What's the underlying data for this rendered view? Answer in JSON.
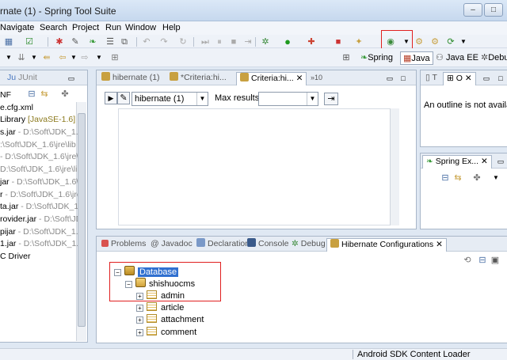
{
  "window": {
    "title": "rnate (1) - Spring Tool Suite",
    "min": "–",
    "max": "□",
    "close": "✕"
  },
  "menu": [
    "Navigate",
    "Search",
    "Project",
    "Run",
    "Window",
    "Help"
  ],
  "toolbar": {
    "perspectives": [
      "Spring",
      "Java",
      "Java EE",
      "Debu"
    ]
  },
  "left_panel": {
    "tab_label": "JUnit",
    "items": [
      {
        "text": "NF",
        "extra": ""
      },
      {
        "text": "e.cfg.xml",
        "extra": ""
      },
      {
        "text": "Library ",
        "extra": "[JavaSE-1.6]"
      },
      {
        "text": "s.jar",
        "extra": " - D:\\Soft\\JDK_1.6"
      },
      {
        "text": "",
        "extra": ":\\Soft\\JDK_1.6\\jre\\lib"
      },
      {
        "text": "",
        "extra": "- D:\\Soft\\JDK_1.6\\jre\\lil"
      },
      {
        "text": "",
        "extra": "D:\\Soft\\JDK_1.6\\jre\\lib"
      },
      {
        "text": "jar",
        "extra": " - D:\\Soft\\JDK_1.6\\jre"
      },
      {
        "text": "r",
        "extra": " - D:\\Soft\\JDK_1.6\\jre\\"
      },
      {
        "text": "ta.jar",
        "extra": " - D:\\Soft\\JDK_1.6"
      },
      {
        "text": "rovider.jar",
        "extra": " - D:\\Soft\\JD"
      },
      {
        "text": "pijar",
        "extra": " - D:\\Soft\\JDK_1."
      },
      {
        "text": "1.jar",
        "extra": " - D:\\Soft\\JDK_1.6"
      },
      {
        "text": "C Driver",
        "extra": ""
      }
    ]
  },
  "editor": {
    "tabs": [
      "hibernate (1)",
      "*Criteria:hi...",
      "Criteria:hi..."
    ],
    "overflow": "»10",
    "session_value": "hibernate (1)",
    "max_results_label": "Max results:",
    "max_results_value": ""
  },
  "outline": {
    "tab1": "T",
    "tab2": "O",
    "message": "An outline is not availab"
  },
  "spring_explorer": {
    "tab": "Spring Ex..."
  },
  "bottom": {
    "tabs": [
      "Problems",
      "Javadoc",
      "Declaration",
      "Console",
      "Debug",
      "Hibernate Configurations"
    ],
    "tree": {
      "root": "Database",
      "schema": "shishuocms",
      "tables": [
        "admin",
        "article",
        "attachment",
        "comment"
      ]
    }
  },
  "status": {
    "text": "Android SDK Content Loader"
  }
}
